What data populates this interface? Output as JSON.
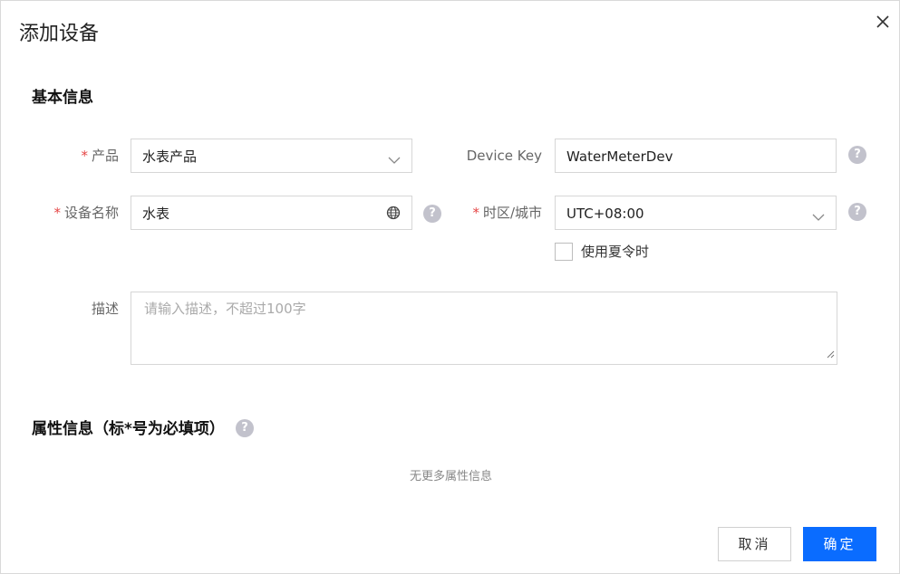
{
  "dialog": {
    "title": "添加设备",
    "close_icon": "close-icon"
  },
  "basic": {
    "section_title": "基本信息",
    "required_mark": "*",
    "product": {
      "label": "产品",
      "value": "水表产品"
    },
    "device_key": {
      "label": "Device Key",
      "value": "WaterMeterDev"
    },
    "device_name": {
      "label": "设备名称",
      "value": "水表"
    },
    "timezone": {
      "label": "时区/城市",
      "value": "UTC+08:00"
    },
    "dst": {
      "label": "使用夏令时",
      "checked": false
    },
    "description": {
      "label": "描述",
      "placeholder": "请输入描述，不超过100字"
    },
    "help_glyph": "?"
  },
  "attributes": {
    "section_title": "属性信息（标*号为必填项）",
    "empty_text": "无更多属性信息"
  },
  "footer": {
    "cancel_label": "取消",
    "confirm_label": "确定"
  },
  "colors": {
    "primary": "#0a6cff",
    "required": "#e54545",
    "help_bg": "#c2c2cc"
  }
}
